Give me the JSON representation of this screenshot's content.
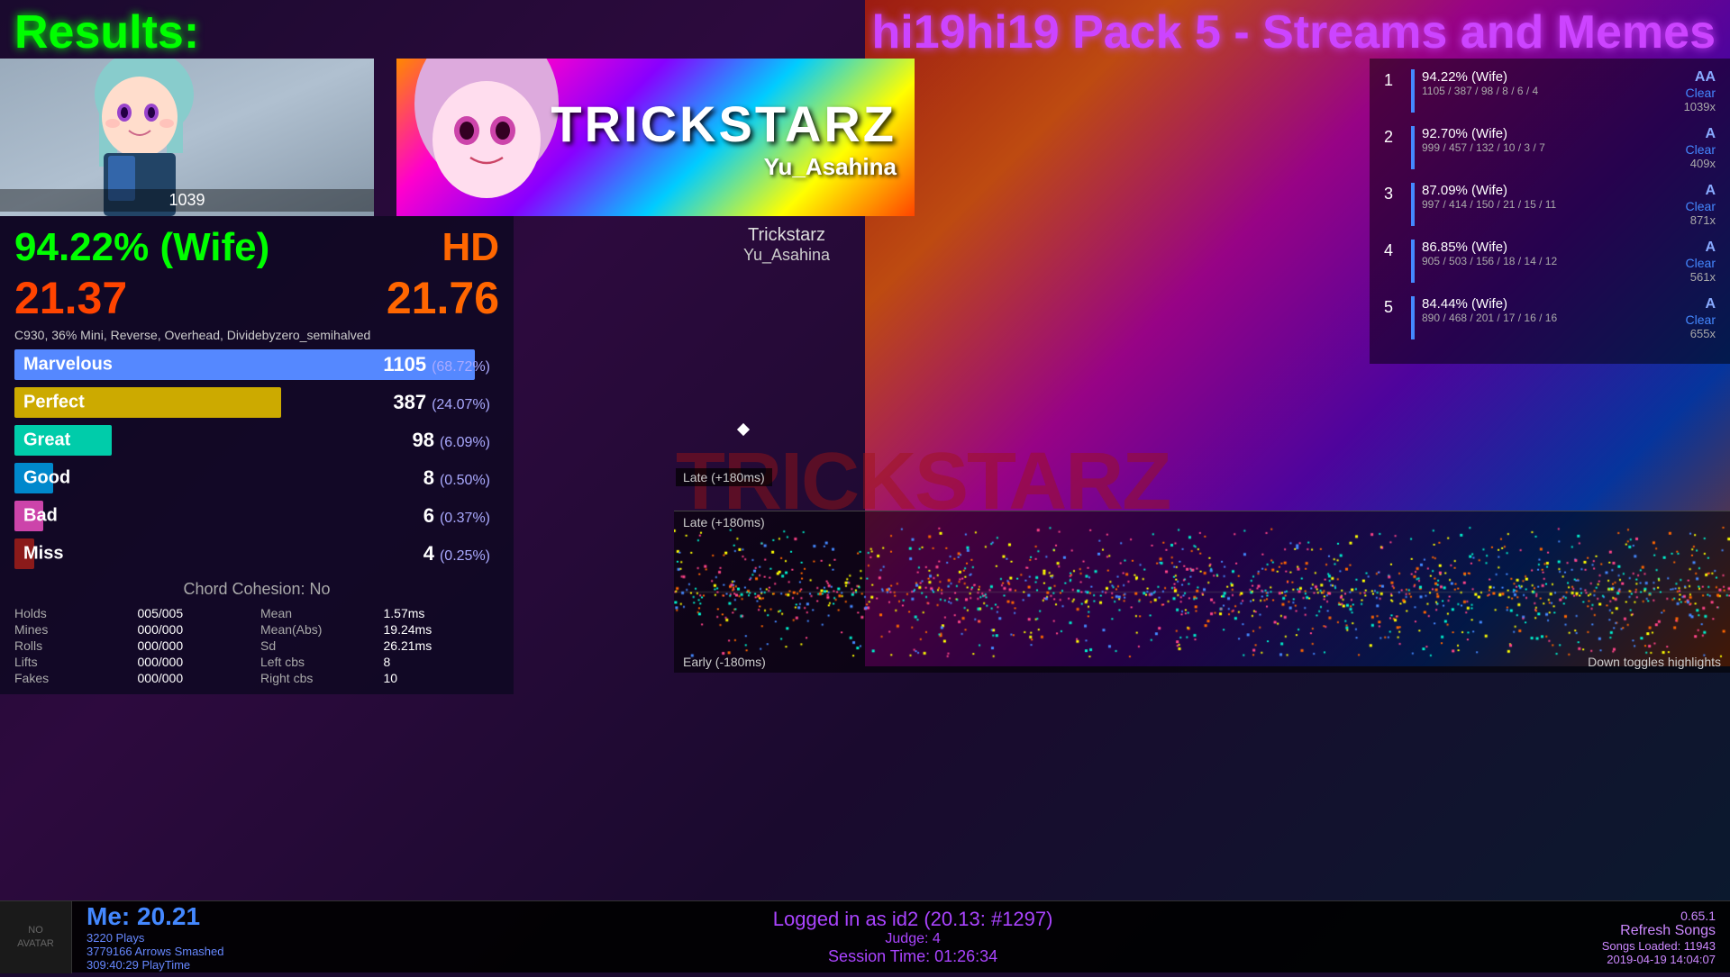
{
  "header": {
    "results_label": "Results:",
    "pack_title": "hi19hi19 Pack 5 - Streams and Memes"
  },
  "song": {
    "title": "TRICKSTARZ",
    "artist": "Yu_Asahina",
    "chart_author": "Trickstarz",
    "score": "1039"
  },
  "gameplay": {
    "accuracy": "94.22% (Wife)",
    "mod": "HD",
    "score_left": "21.37",
    "score_right": "21.76",
    "options": "C930, 36% Mini, Reverse, Overhead, Dividebyzero_semihalved",
    "chord_cohesion": "Chord Cohesion: No"
  },
  "judgments": [
    {
      "label": "Marvelous",
      "count": "1105",
      "pct": "68.72%",
      "color": "#5588ff",
      "bar_width": "95%"
    },
    {
      "label": "Perfect",
      "count": "387",
      "pct": "24.07%",
      "color": "#ccaa00",
      "bar_width": "55%"
    },
    {
      "label": "Great",
      "count": "98",
      "pct": "6.09%",
      "color": "#00ccaa",
      "bar_width": "20%"
    },
    {
      "label": "Good",
      "count": "8",
      "pct": "0.50%",
      "color": "#0088cc",
      "bar_width": "8%"
    },
    {
      "label": "Bad",
      "count": "6",
      "pct": "0.37%",
      "color": "#cc44aa",
      "bar_width": "6%"
    },
    {
      "label": "Miss",
      "count": "4",
      "pct": "0.25%",
      "color": "#8b1a1a",
      "bar_width": "4%"
    }
  ],
  "extra_stats": {
    "holds_label": "Holds",
    "holds_value": "005/005",
    "mines_label": "Mines",
    "mines_value": "000/000",
    "rolls_label": "Rolls",
    "rolls_value": "000/000",
    "lifts_label": "Lifts",
    "lifts_value": "000/000",
    "fakes_label": "Fakes",
    "fakes_value": "000/000",
    "mean_label": "Mean",
    "mean_value": "1.57ms",
    "mean_abs_label": "Mean(Abs)",
    "mean_abs_value": "19.24ms",
    "sd_label": "Sd",
    "sd_value": "26.21ms",
    "left_cbs_label": "Left cbs",
    "left_cbs_value": "8",
    "right_cbs_label": "Right cbs",
    "right_cbs_value": "10"
  },
  "leaderboard": [
    {
      "rank": "1",
      "pct": "94.22% (Wife)",
      "hits": "1105 / 387 / 98 / 8 / 6 / 4",
      "grade": "AA",
      "clear": "Clear",
      "combo": "1039x"
    },
    {
      "rank": "2",
      "pct": "92.70% (Wife)",
      "hits": "999 / 457 / 132 / 10 / 3 / 7",
      "grade": "A",
      "clear": "Clear",
      "combo": "409x"
    },
    {
      "rank": "3",
      "pct": "87.09% (Wife)",
      "hits": "997 / 414 / 150 / 21 / 15 / 11",
      "grade": "A",
      "clear": "Clear",
      "combo": "871x"
    },
    {
      "rank": "4",
      "pct": "86.85% (Wife)",
      "hits": "905 / 503 / 156 / 18 / 14 / 12",
      "grade": "A",
      "clear": "Clear",
      "combo": "561x"
    },
    {
      "rank": "5",
      "pct": "84.44% (Wife)",
      "hits": "890 / 468 / 201 / 17 / 16 / 16",
      "grade": "A",
      "clear": "Clear",
      "combo": "655x"
    }
  ],
  "scatter": {
    "late_label": "Late (+180ms)",
    "early_label": "Early (-180ms)",
    "toggles_label": "Down toggles highlights"
  },
  "footer": {
    "no_avatar": "NO\nAVATAR",
    "me_label": "Me: 20.21",
    "plays": "3220 Plays",
    "arrows": "3779166 Arrows Smashed",
    "playtime": "309:40:29 PlayTime",
    "logged_in": "Logged in as id2 (20.13: #1297)",
    "judge_label": "Judge: 4",
    "session_time": "Session Time: 01:26:34",
    "version": "0.65.1",
    "refresh_songs": "Refresh Songs",
    "songs_loaded": "Songs Loaded: 11943",
    "date": "2019-04-19 14:04:07"
  }
}
